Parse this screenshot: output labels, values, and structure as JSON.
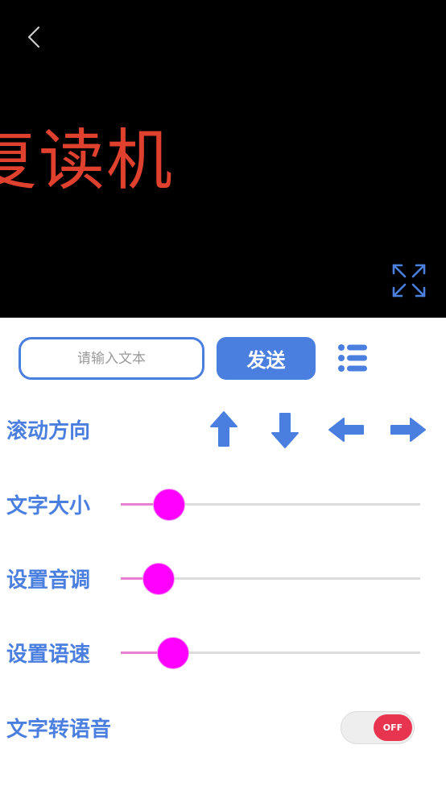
{
  "display": {
    "marquee_text": "复读机",
    "text_color": "#e0402e",
    "background": "#000000",
    "back_icon": "chevron-left-icon",
    "fullscreen_icon": "expand-icon"
  },
  "input": {
    "placeholder": "请输入文本",
    "value": ""
  },
  "send_label": "发送",
  "list_icon": "list-icon",
  "scroll": {
    "label": "滚动方向",
    "directions": [
      "up",
      "down",
      "left",
      "right"
    ]
  },
  "sliders": [
    {
      "label": "文字大小",
      "value": 0.16
    },
    {
      "label": "设置音调",
      "value": 0.125
    },
    {
      "label": "设置语速",
      "value": 0.175
    }
  ],
  "tts": {
    "label": "文字转语音",
    "state": "OFF"
  },
  "colors": {
    "accent": "#4a7fe0",
    "slider_thumb": "#ff00ff",
    "slider_fill": "#e87fd0",
    "toggle_off": "#e8344e"
  }
}
